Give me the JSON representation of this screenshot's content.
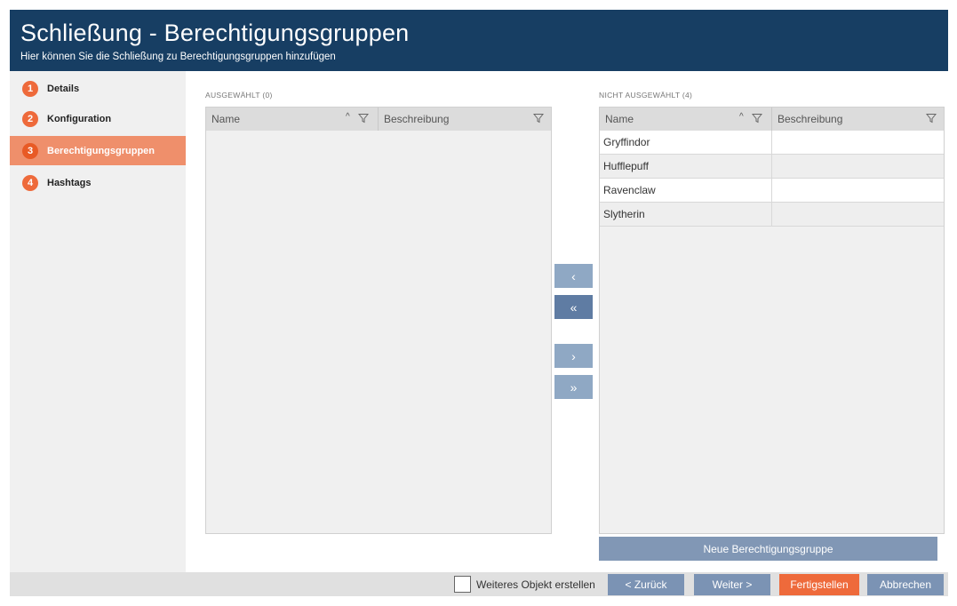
{
  "header": {
    "title": "Schließung - Berechtigungsgruppen",
    "subtitle": "Hier können Sie die Schließung zu Berechtigungsgruppen hinzufügen"
  },
  "steps": [
    {
      "num": "1",
      "label": "Details"
    },
    {
      "num": "2",
      "label": "Konfiguration"
    },
    {
      "num": "3",
      "label": "Berechtigungsgruppen",
      "active": true
    },
    {
      "num": "4",
      "label": "Hashtags"
    }
  ],
  "selected": {
    "label": "AUSGEWÄHLT (0)",
    "columns": [
      "Name",
      "Beschreibung"
    ],
    "rows": []
  },
  "unselected": {
    "label": "NICHT AUSGEWÄHLT (4)",
    "columns": [
      "Name",
      "Beschreibung"
    ],
    "rows": [
      {
        "name": "Gryffindor",
        "description": ""
      },
      {
        "name": "Hufflepuff",
        "description": ""
      },
      {
        "name": "Ravenclaw",
        "description": ""
      },
      {
        "name": "Slytherin",
        "description": ""
      }
    ]
  },
  "transfer": {
    "move_one_left": "‹",
    "move_all_left": "«",
    "move_one_right": "›",
    "move_all_right": "»"
  },
  "icons": {
    "sort": "sort-ascending-icon",
    "filter": "filter-funnel-icon"
  },
  "new_group_button": "Neue Berechtigungsgruppe",
  "footer": {
    "checkbox_label": "Weiteres Objekt erstellen",
    "back": "< Zurück",
    "next": "Weiter >",
    "finish": "Fertigstellen",
    "cancel": "Abbrechen"
  },
  "colors": {
    "header_bg": "#173e63",
    "accent": "#ee6a3b",
    "active_step": "#ef8f6b",
    "button_blue": "#7b93b4"
  }
}
